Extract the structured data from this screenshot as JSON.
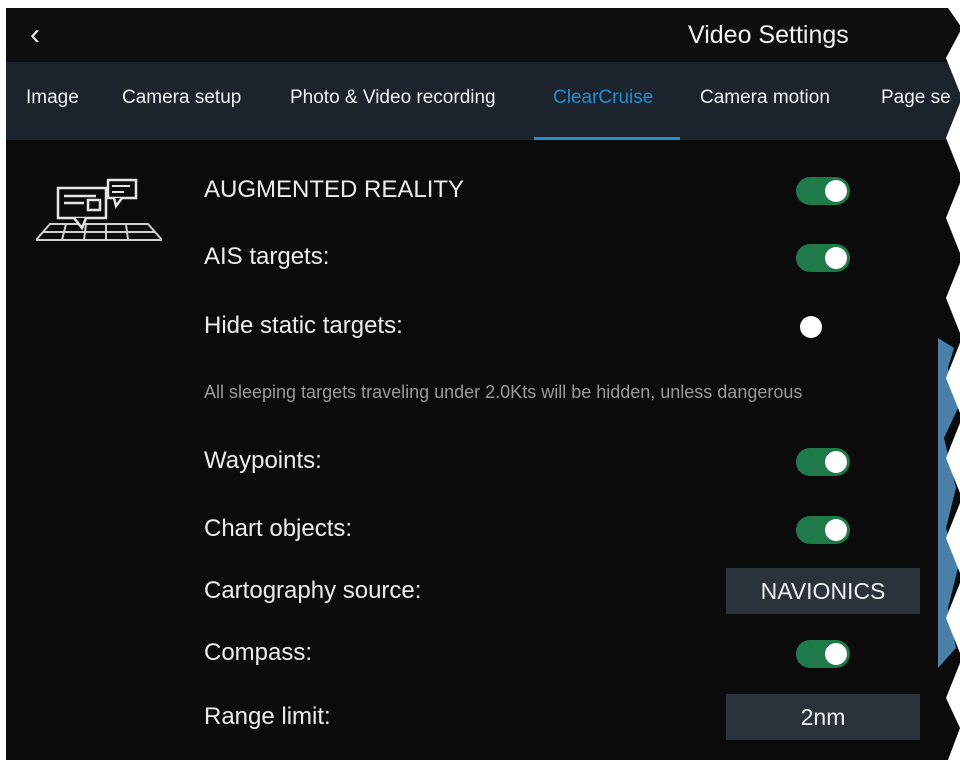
{
  "window": {
    "title": "Video Settings",
    "back_icon": "chevron-left-icon",
    "back_glyph": "‹"
  },
  "tabs": [
    {
      "label": "Image",
      "active": false
    },
    {
      "label": "Camera setup",
      "active": false
    },
    {
      "label": "Photo & Video recording",
      "active": false
    },
    {
      "label": "ClearCruise",
      "active": true
    },
    {
      "label": "Camera motion",
      "active": false
    },
    {
      "label": "Page se",
      "active": false
    }
  ],
  "section": {
    "icon": "augmented-reality-icon"
  },
  "settings": {
    "augmented_reality": {
      "label": "AUGMENTED REALITY",
      "on": true
    },
    "ais_targets": {
      "label": "AIS targets:",
      "on": true
    },
    "hide_static_targets": {
      "label": "Hide static targets:",
      "on": false
    },
    "hide_static_note": "All sleeping targets traveling under 2.0Kts will be hidden, unless dangerous",
    "waypoints": {
      "label": "Waypoints:",
      "on": true
    },
    "chart_objects": {
      "label": "Chart objects:",
      "on": true
    },
    "cartography_source": {
      "label": "Cartography source:",
      "value": "NAVIONICS"
    },
    "compass": {
      "label": "Compass:",
      "on": true
    },
    "range_limit": {
      "label": "Range limit:",
      "value": "2nm"
    }
  },
  "colors": {
    "accent": "#1f8fd0",
    "toggle_on": "#1f7a4a",
    "tab_bar": "#1d232c",
    "background": "#0b0b0b"
  }
}
